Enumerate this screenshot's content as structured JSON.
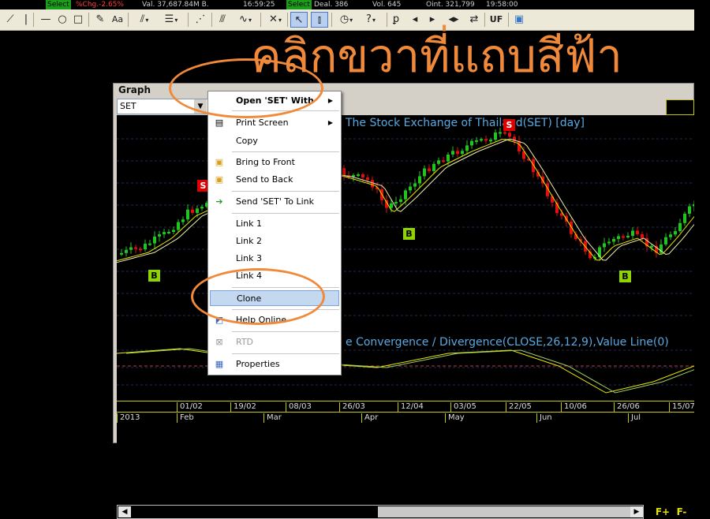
{
  "ticker": {
    "items": [
      {
        "text": "Select",
        "kind": "select"
      },
      {
        "text": "%Chg.-2.65%",
        "kind": "red"
      },
      {
        "text": "Val. 37,687.84M B.",
        "kind": "normal"
      },
      {
        "text": "16:59:25",
        "kind": "normal"
      },
      {
        "text": "Select",
        "kind": "select"
      },
      {
        "text": "Deal. 386",
        "kind": "normal"
      },
      {
        "text": "Vol. 645",
        "kind": "normal"
      },
      {
        "text": "Oint. 321,799",
        "kind": "normal"
      },
      {
        "text": "19:58:00",
        "kind": "normal"
      }
    ]
  },
  "toolbar": {
    "aa_label": "Aa",
    "uf_label": "UF"
  },
  "annotation": {
    "text": "คลิกขวาที่แถบสีฟ้า",
    "color": "#f08a3a"
  },
  "graph": {
    "title": "Graph",
    "symbol": "SET",
    "price_title": "The Stock Exchange of Thailand(SET) [day]",
    "indicator_title": "e Convergence / Divergence(CLOSE,26,12,9),Value Line(0)",
    "signals": [
      {
        "label": "B",
        "type": "buy"
      },
      {
        "label": "S",
        "type": "sell"
      },
      {
        "label": "B",
        "type": "buy"
      },
      {
        "label": "S",
        "type": "sell"
      },
      {
        "label": "B",
        "type": "buy"
      }
    ],
    "timeline_dates": [
      "01/02",
      "19/02",
      "08/03",
      "26/03",
      "12/04",
      "03/05",
      "22/05",
      "10/06",
      "26/06",
      "15/07"
    ],
    "timeline_months": [
      "2013",
      "Feb",
      "Mar",
      "Apr",
      "May",
      "Jun",
      "Jul"
    ],
    "f_plus": "F+",
    "f_minus": "F-"
  },
  "context_menu": {
    "items": [
      {
        "label": "Open 'SET' With",
        "bold": true,
        "submenu": true,
        "icon": ""
      },
      {
        "label": "Print Screen",
        "submenu": true,
        "icon": "print-icon"
      },
      {
        "label": "Copy",
        "icon": ""
      },
      {
        "label": "Bring to Front",
        "icon": "bring-front-icon"
      },
      {
        "label": "Send to Back",
        "icon": "send-back-icon"
      },
      {
        "label": "Send 'SET' To Link",
        "icon": "arrow-right-icon"
      },
      {
        "label": "Link 1",
        "icon": ""
      },
      {
        "label": "Link 2",
        "icon": ""
      },
      {
        "label": "Link 3",
        "icon": ""
      },
      {
        "label": "Link 4",
        "icon": ""
      },
      {
        "label": "Clone",
        "highlighted": true,
        "icon": ""
      },
      {
        "label": "Help Online",
        "icon": "help-icon"
      },
      {
        "label": "RTD",
        "disabled": true,
        "icon": "rtd-icon"
      },
      {
        "label": "Properties",
        "icon": "properties-icon"
      }
    ]
  },
  "colors": {
    "candle_up": "#22c422",
    "candle_down": "#e01010",
    "ma_fast": "#e8e800",
    "ma_slow": "#f0f0b0",
    "macd_line": "#e8e800",
    "signal_line": "#a0d060",
    "grid": "#1e2a5a",
    "zero_line": "#c04040"
  }
}
